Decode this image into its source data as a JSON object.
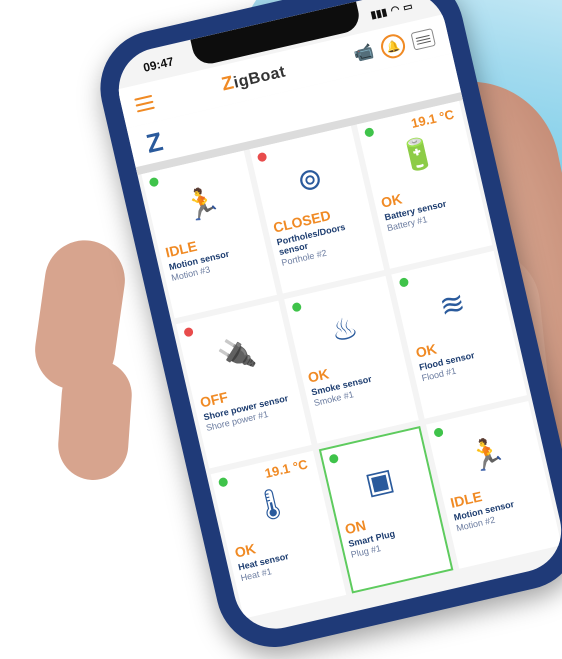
{
  "status": {
    "time": "09:47"
  },
  "app": {
    "logo_prefix": "Z",
    "logo_text": "igBoat",
    "brand_mark": "Z"
  },
  "colors": {
    "accent": "#f08a24",
    "navy": "#2a5a9c",
    "ok": "#3fc34a",
    "alert": "#e84c4c",
    "phone": "#1f3a78"
  },
  "tiles": [
    {
      "dot": "green",
      "icon": "running-person-icon",
      "glyph": "🏃",
      "temp": "",
      "state": "IDLE",
      "sensor": "Motion sensor",
      "name": "Motion #3"
    },
    {
      "dot": "red",
      "icon": "porthole-icon",
      "glyph": "⊚",
      "temp": "",
      "state": "CLOSED",
      "sensor": "Portholes/Doors sensor",
      "name": "Porthole #2"
    },
    {
      "dot": "green",
      "icon": "battery-icon",
      "glyph": "🔋",
      "temp": "19.1 °C",
      "state": "OK",
      "sensor": "Battery sensor",
      "name": "Battery #1"
    },
    {
      "dot": "red",
      "icon": "power-plug-icon",
      "glyph": "🔌",
      "temp": "",
      "state": "OFF",
      "sensor": "Shore power sensor",
      "name": "Shore power #1"
    },
    {
      "dot": "green",
      "icon": "smoke-icon",
      "glyph": "♨",
      "temp": "",
      "state": "OK",
      "sensor": "Smoke sensor",
      "name": "Smoke #1"
    },
    {
      "dot": "green",
      "icon": "flood-icon",
      "glyph": "≋",
      "temp": "",
      "state": "OK",
      "sensor": "Flood sensor",
      "name": "Flood #1"
    },
    {
      "dot": "green",
      "icon": "thermometer-icon",
      "glyph": "🌡",
      "temp": "19.1 °C",
      "state": "OK",
      "sensor": "Heat sensor",
      "name": "Heat #1"
    },
    {
      "dot": "green",
      "icon": "smart-plug-icon",
      "glyph": "▣",
      "temp": "",
      "state": "ON",
      "sensor": "Smart Plug",
      "name": "Plug #1",
      "active": true
    },
    {
      "dot": "green",
      "icon": "running-person-icon",
      "glyph": "🏃",
      "temp": "",
      "state": "IDLE",
      "sensor": "Motion sensor",
      "name": "Motion #2"
    }
  ]
}
